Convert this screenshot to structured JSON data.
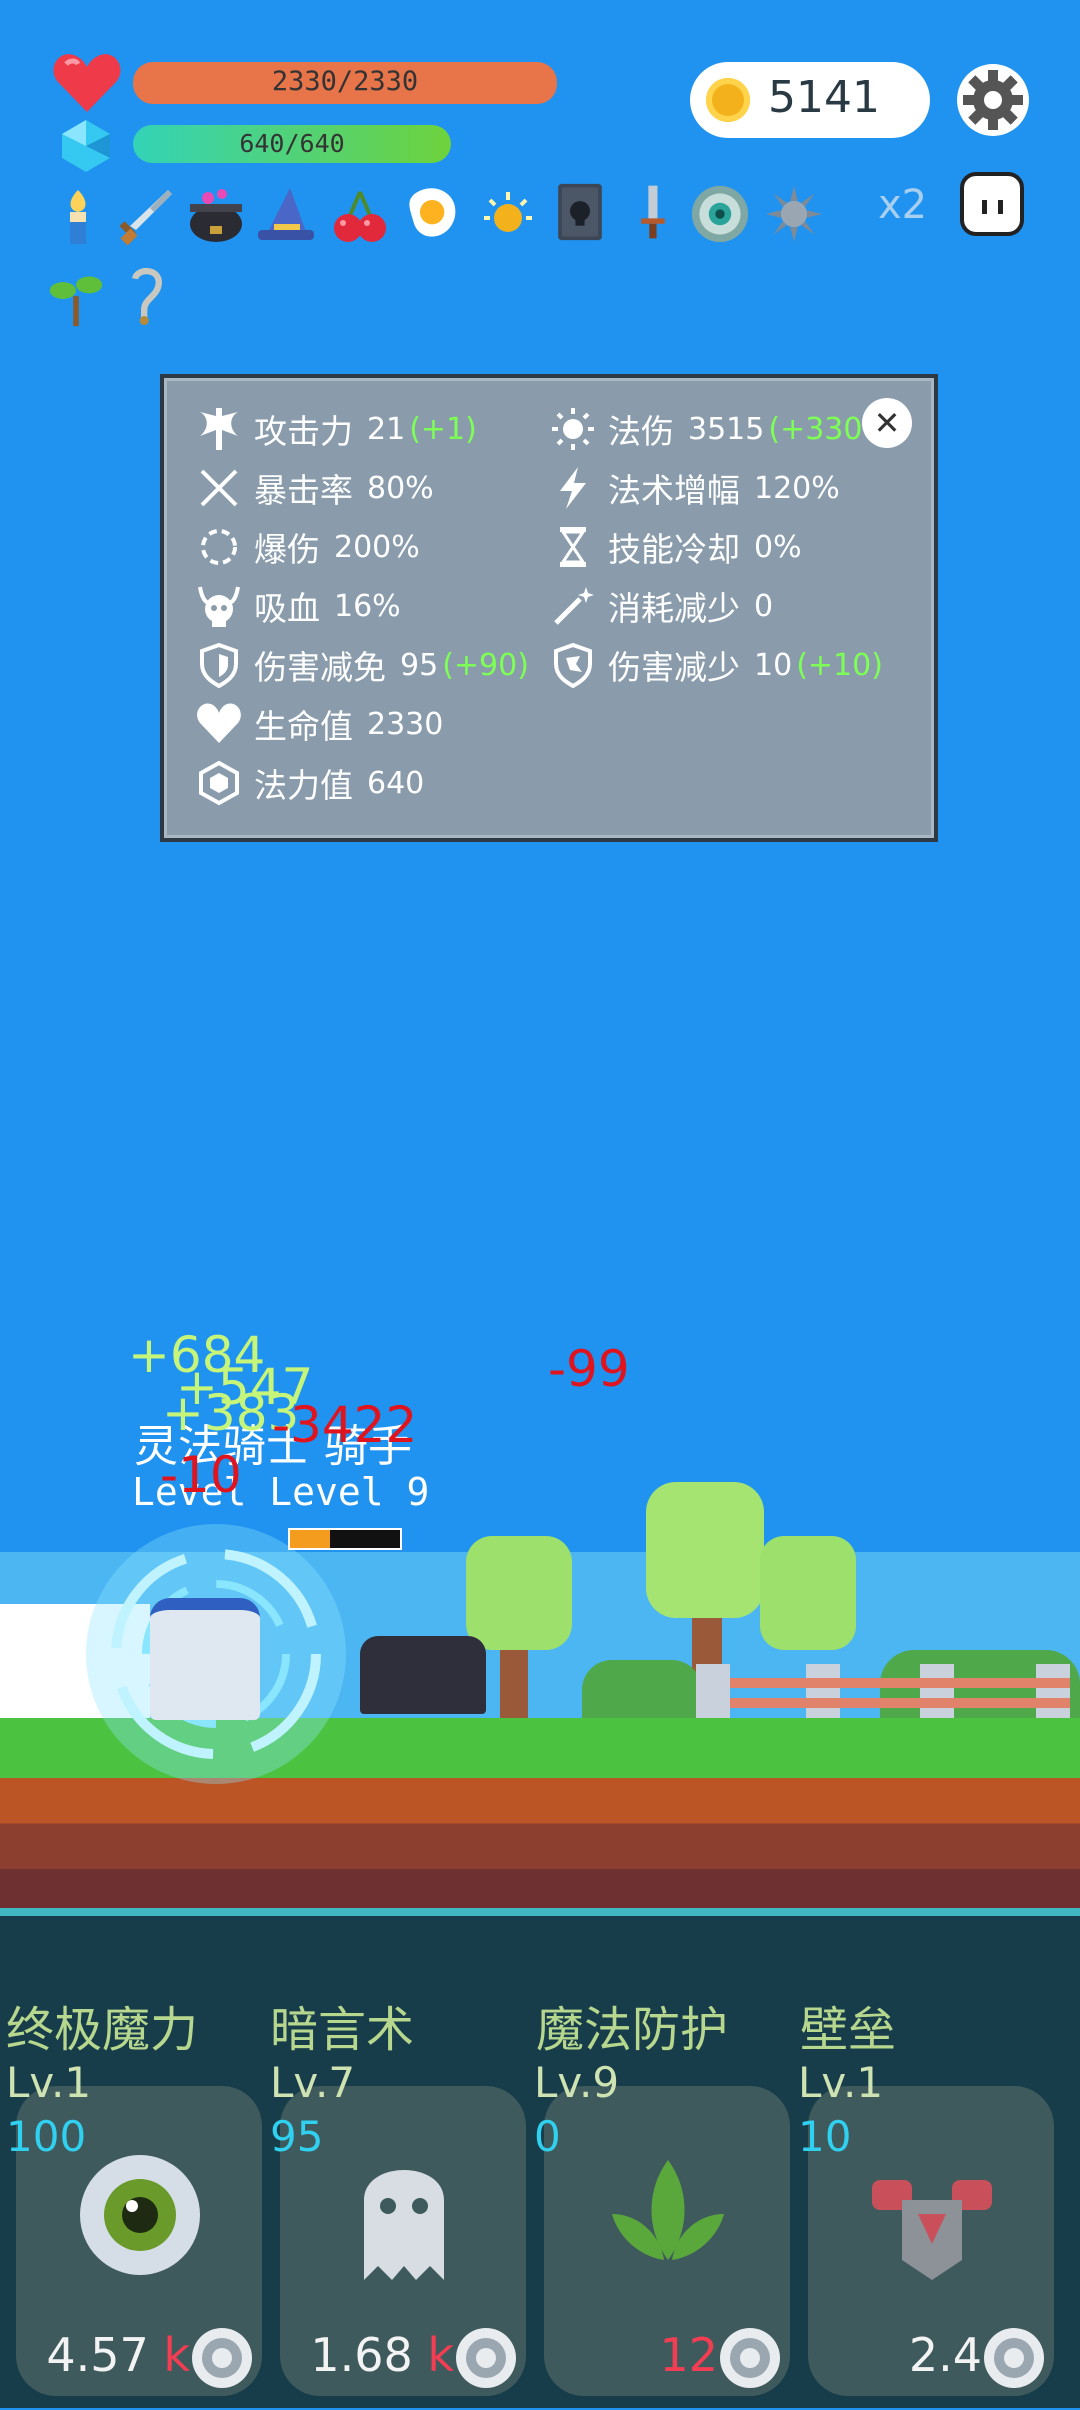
{
  "hud": {
    "hp": "2330/2330",
    "mp": "640/640",
    "coins": "5141",
    "multiplier": "x2"
  },
  "items": [
    "torch-icon",
    "sword-icon",
    "cauldron-icon",
    "wizard-hat-icon",
    "cherries-icon",
    "fried-egg-icon",
    "sun-orb-icon",
    "skull-book-icon",
    "dagger-icon",
    "eye-ring-icon",
    "spiked-ball-icon",
    "sapling-icon",
    "hook-icon"
  ],
  "stats": {
    "left": [
      {
        "label": "攻击力",
        "value": "21",
        "bonus": "(+1)",
        "icon": "axe-icon"
      },
      {
        "label": "暴击率",
        "value": "80%",
        "bonus": "",
        "icon": "crossed-blades-icon"
      },
      {
        "label": "爆伤",
        "value": "200%",
        "bonus": "",
        "icon": "burst-ring-icon"
      },
      {
        "label": "吸血",
        "value": "16%",
        "bonus": "",
        "icon": "horned-skull-icon"
      },
      {
        "label": "伤害减免",
        "value": "95",
        "bonus": "(+90)",
        "icon": "shield-icon"
      },
      {
        "label": "生命值",
        "value": "2330",
        "bonus": "",
        "icon": "heart-icon"
      },
      {
        "label": "法力值",
        "value": "640",
        "bonus": "",
        "icon": "gem-icon"
      }
    ],
    "right": [
      {
        "label": "法伤",
        "value": "3515",
        "bonus": "(+330",
        "icon": "sun-icon"
      },
      {
        "label": "法术增幅",
        "value": "120%",
        "bonus": "",
        "icon": "lightning-icon"
      },
      {
        "label": "技能冷却",
        "value": "0%",
        "bonus": "",
        "icon": "hourglass-icon"
      },
      {
        "label": "消耗减少",
        "value": "0",
        "bonus": "",
        "icon": "magic-wand-icon"
      },
      {
        "label": "伤害减少",
        "value": "10",
        "bonus": "(+10)",
        "icon": "dragon-shield-icon"
      }
    ]
  },
  "battle": {
    "float_green_1": "+684",
    "float_green_2": "+547",
    "float_green_3": "+383",
    "float_red_1": "-3422",
    "float_red_2": "-99",
    "float_red_3": "-10",
    "enemy_name": "灵法骑士 骑手",
    "enemy_level": "Level Level 9"
  },
  "skills": [
    {
      "name": "终极魔力",
      "lv": "Lv.1",
      "cost": "100",
      "price": "4.57",
      "unit": "k",
      "icon": "eyeball-icon"
    },
    {
      "name": "暗言术",
      "lv": "Lv.7",
      "cost": "95",
      "price": "1.68",
      "unit": "k",
      "icon": "ghost-icon"
    },
    {
      "name": "魔法防护",
      "lv": "Lv.9",
      "cost": "0",
      "price": "12",
      "unit": "",
      "icon": "leaf-icon"
    },
    {
      "name": "壁垒",
      "lv": "Lv.1",
      "cost": "10",
      "price": "2.4",
      "unit": "",
      "icon": "armor-icon"
    }
  ]
}
